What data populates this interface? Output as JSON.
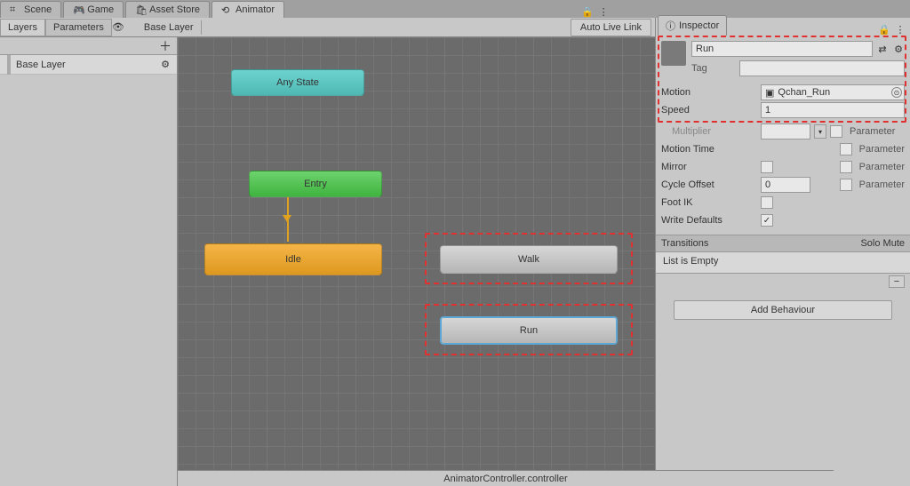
{
  "top_tabs": {
    "scene": "Scene",
    "game": "Game",
    "asset_store": "Asset Store",
    "animator": "Animator"
  },
  "animator": {
    "left_tabs": {
      "layers": "Layers",
      "parameters": "Parameters"
    },
    "breadcrumb": "Base Layer",
    "auto_live_link": "Auto Live Link",
    "layer_item": "Base Layer",
    "nodes": {
      "any_state": "Any State",
      "entry": "Entry",
      "idle": "Idle",
      "walk": "Walk",
      "run": "Run"
    },
    "footer": "AnimatorController.controller"
  },
  "inspector": {
    "tab": "Inspector",
    "state_name": "Run",
    "tag_label": "Tag",
    "tag_value": "",
    "motion_label": "Motion",
    "motion_value": "Qchan_Run",
    "speed_label": "Speed",
    "speed_value": "1",
    "multiplier_label": "Multiplier",
    "motion_time_label": "Motion Time",
    "mirror_label": "Mirror",
    "cycle_offset_label": "Cycle Offset",
    "cycle_offset_value": "0",
    "foot_ik_label": "Foot IK",
    "write_defaults_label": "Write Defaults",
    "parameter_label": "Parameter",
    "transitions_label": "Transitions",
    "solo_mute": "Solo  Mute",
    "list_empty": "List is Empty",
    "add_behaviour": "Add Behaviour"
  }
}
